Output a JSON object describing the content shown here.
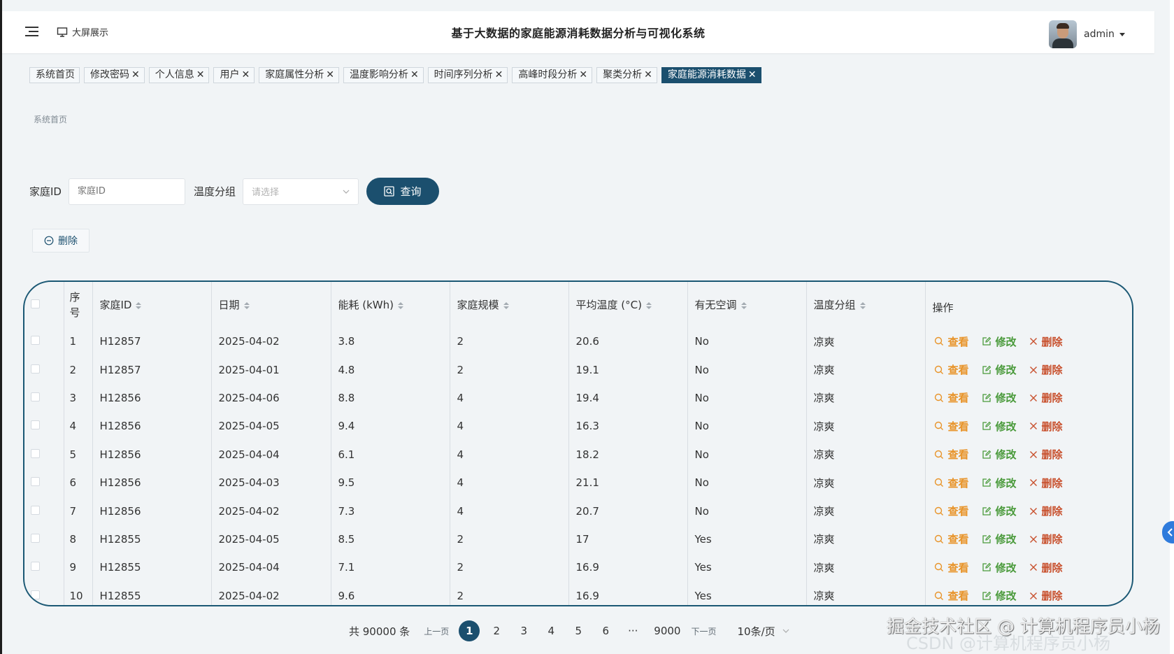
{
  "header": {
    "screen_link": "大屏展示",
    "title": "基于大数据的家庭能源消耗数据分析与可视化系统",
    "user": "admin"
  },
  "tabs": [
    {
      "label": "系统首页",
      "closable": false
    },
    {
      "label": "修改密码",
      "closable": true
    },
    {
      "label": "个人信息",
      "closable": true
    },
    {
      "label": "用户",
      "closable": true
    },
    {
      "label": "家庭属性分析",
      "closable": true
    },
    {
      "label": "温度影响分析",
      "closable": true
    },
    {
      "label": "时间序列分析",
      "closable": true
    },
    {
      "label": "高峰时段分析",
      "closable": true
    },
    {
      "label": "聚类分析",
      "closable": true
    },
    {
      "label": "家庭能源消耗数据",
      "closable": true,
      "active": true
    }
  ],
  "breadcrumb": "系统首页",
  "search": {
    "household_label": "家庭ID",
    "household_placeholder": "家庭ID",
    "temp_group_label": "温度分组",
    "temp_group_placeholder": "请选择",
    "query_label": "查询"
  },
  "toolbar": {
    "delete_label": "删除"
  },
  "table": {
    "columns": [
      "序号",
      "家庭ID",
      "日期",
      "能耗 (kWh)",
      "家庭规模",
      "平均温度 (°C)",
      "有无空调",
      "温度分组",
      "操作"
    ],
    "actions": {
      "view": "查看",
      "edit": "修改",
      "delete": "删除"
    },
    "rows": [
      [
        "1",
        "H12857",
        "2025-04-02",
        "3.8",
        "2",
        "20.6",
        "No",
        "凉爽"
      ],
      [
        "2",
        "H12857",
        "2025-04-01",
        "4.8",
        "2",
        "19.1",
        "No",
        "凉爽"
      ],
      [
        "3",
        "H12856",
        "2025-04-06",
        "8.8",
        "4",
        "19.4",
        "No",
        "凉爽"
      ],
      [
        "4",
        "H12856",
        "2025-04-05",
        "9.4",
        "4",
        "16.3",
        "No",
        "凉爽"
      ],
      [
        "5",
        "H12856",
        "2025-04-04",
        "6.1",
        "4",
        "18.2",
        "No",
        "凉爽"
      ],
      [
        "6",
        "H12856",
        "2025-04-03",
        "9.5",
        "4",
        "21.1",
        "No",
        "凉爽"
      ],
      [
        "7",
        "H12856",
        "2025-04-02",
        "7.3",
        "4",
        "20.7",
        "No",
        "凉爽"
      ],
      [
        "8",
        "H12855",
        "2025-04-05",
        "8.5",
        "2",
        "17",
        "Yes",
        "凉爽"
      ],
      [
        "9",
        "H12855",
        "2025-04-04",
        "7.1",
        "2",
        "16.9",
        "Yes",
        "凉爽"
      ],
      [
        "10",
        "H12855",
        "2025-04-02",
        "9.6",
        "2",
        "16.9",
        "Yes",
        "凉爽"
      ]
    ]
  },
  "pagination": {
    "total": "共 90000 条",
    "prev": "上一页",
    "next": "下一页",
    "pages": [
      "1",
      "2",
      "3",
      "4",
      "5",
      "6",
      "···",
      "9000"
    ],
    "current": "1",
    "page_size": "10条/页"
  },
  "watermark": "掘金技术社区 @ 计算机程序员小杨",
  "watermark_faint": "CSDN @计算机程序员小杨",
  "colors": {
    "primary": "#1b4f6e",
    "view": "#e8942a",
    "edit": "#4a9a3b",
    "delete": "#c8502d"
  }
}
